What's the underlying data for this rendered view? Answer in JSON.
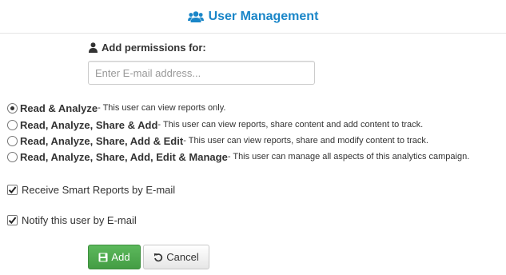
{
  "header": {
    "title": "User Management",
    "icon": "users-icon",
    "title_color": "#1a86c8"
  },
  "form": {
    "permissions_label": "Add permissions for:",
    "email_placeholder": "Enter E-mail address...",
    "email_value": ""
  },
  "permissions": [
    {
      "title": "Read & Analyze",
      "desc": " - This user can view reports only.",
      "checked": true
    },
    {
      "title": "Read, Analyze, Share & Add",
      "desc": " - This user can view reports, share content and add content to track.",
      "checked": false
    },
    {
      "title": "Read, Analyze, Share, Add & Edit",
      "desc": " - This user can view reports, share and modify content to track.",
      "checked": false
    },
    {
      "title": "Read, Analyze, Share, Add, Edit & Manage",
      "desc": " - This user can manage all aspects of this analytics campaign.",
      "checked": false
    }
  ],
  "options": {
    "smart_reports_label": "Receive Smart Reports by E-mail",
    "smart_reports_checked": true,
    "notify_label": "Notify this user by E-mail",
    "notify_checked": true
  },
  "buttons": {
    "add_label": "Add",
    "cancel_label": "Cancel",
    "add_color": "#5cb85c"
  }
}
